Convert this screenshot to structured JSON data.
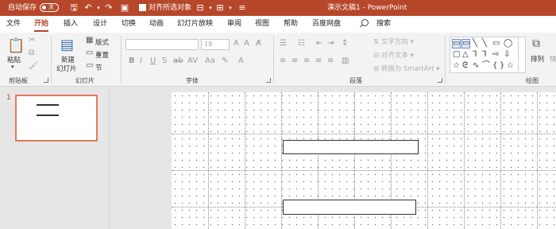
{
  "titlebar": {
    "autosave_label": "自动保存",
    "autosave_state": "关",
    "align_checkbox_label": "对齐所选对象",
    "document_title": "演示文稿1  -  PowerPoint",
    "search_label": "搜索"
  },
  "tabs": [
    "文件",
    "开始",
    "插入",
    "设计",
    "切换",
    "动画",
    "幻灯片放映",
    "审阅",
    "视图",
    "帮助",
    "百度网盘"
  ],
  "ribbon": {
    "clipboard": {
      "paste": "粘贴",
      "group": "剪贴板"
    },
    "slides": {
      "new_slide_line1": "新建",
      "new_slide_line2": "幻灯片",
      "layout": "版式",
      "reset": "重置",
      "section": "节",
      "group": "幻灯片"
    },
    "font": {
      "size": "18",
      "group": "字体"
    },
    "paragraph": {
      "text_direction": "文字方向",
      "align_text": "对齐文本",
      "smartart": "转换为 SmartArt",
      "group": "段落"
    },
    "drawing": {
      "arrange": "排列",
      "quick_styles": "快",
      "group": "绘图"
    }
  },
  "thumbnails": {
    "slide_number": "1"
  },
  "colors": {
    "accent": "#b7472a",
    "thumb_border": "#e37a5e"
  }
}
